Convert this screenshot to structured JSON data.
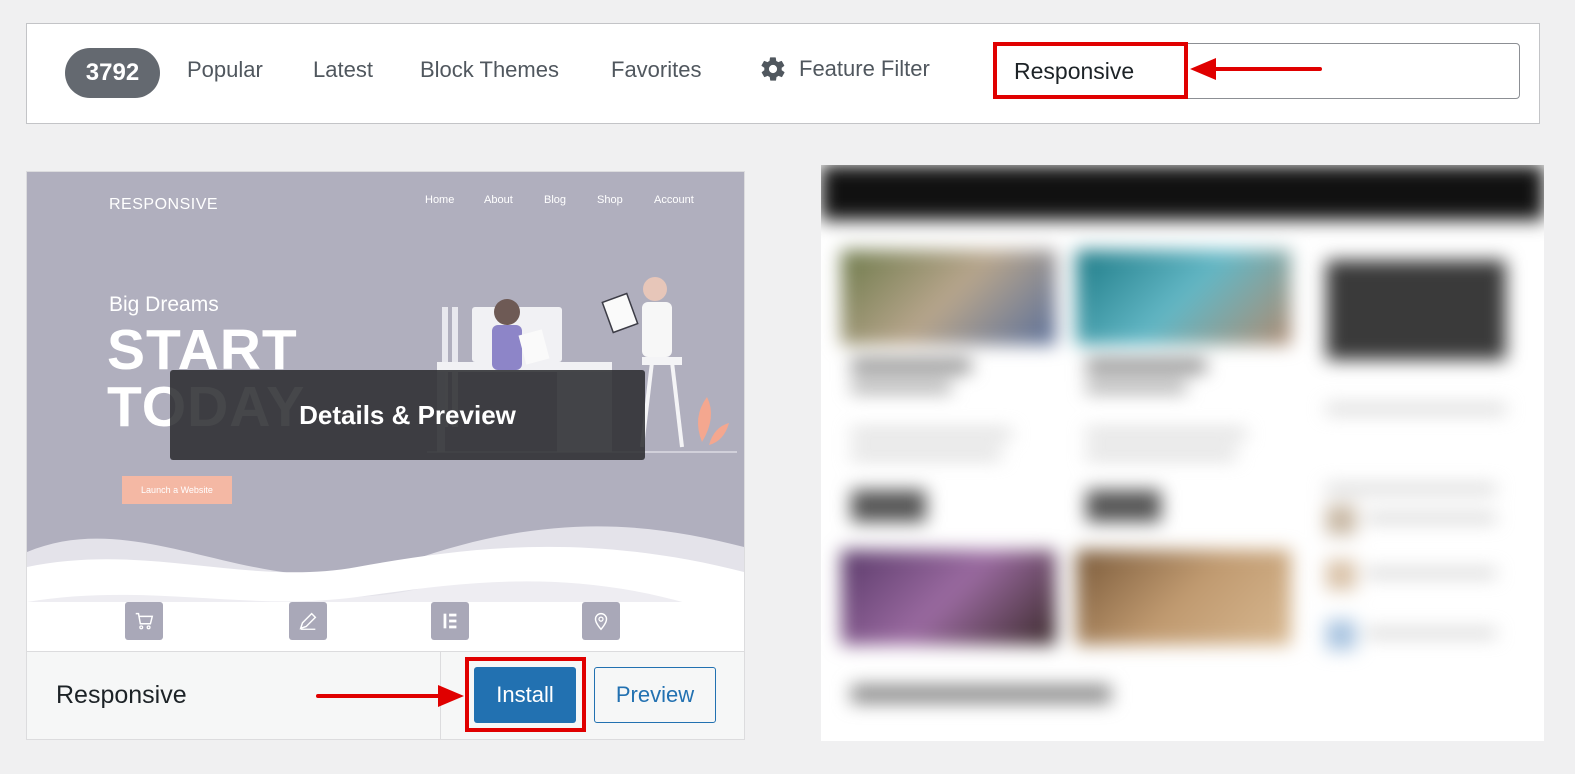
{
  "filter_bar": {
    "count": "3792",
    "tabs": [
      {
        "label": "Popular"
      },
      {
        "label": "Latest"
      },
      {
        "label": "Block Themes"
      },
      {
        "label": "Favorites"
      }
    ],
    "feature_filter_label": "Feature Filter",
    "search_value": "Responsive"
  },
  "theme_card": {
    "screenshot": {
      "logo": "RESPONSIVE",
      "nav": [
        "Home",
        "About",
        "Blog",
        "Shop",
        "Account"
      ],
      "tagline": "Big Dreams",
      "headline_line1": "START",
      "headline_line2": "TODAY",
      "cta": "Launch a Website"
    },
    "overlay_label": "Details & Preview",
    "name": "Responsive",
    "install_label": "Install",
    "preview_label": "Preview"
  },
  "colors": {
    "primary_button": "#2271b1",
    "highlight": "#e00000",
    "badge": "#646970"
  }
}
